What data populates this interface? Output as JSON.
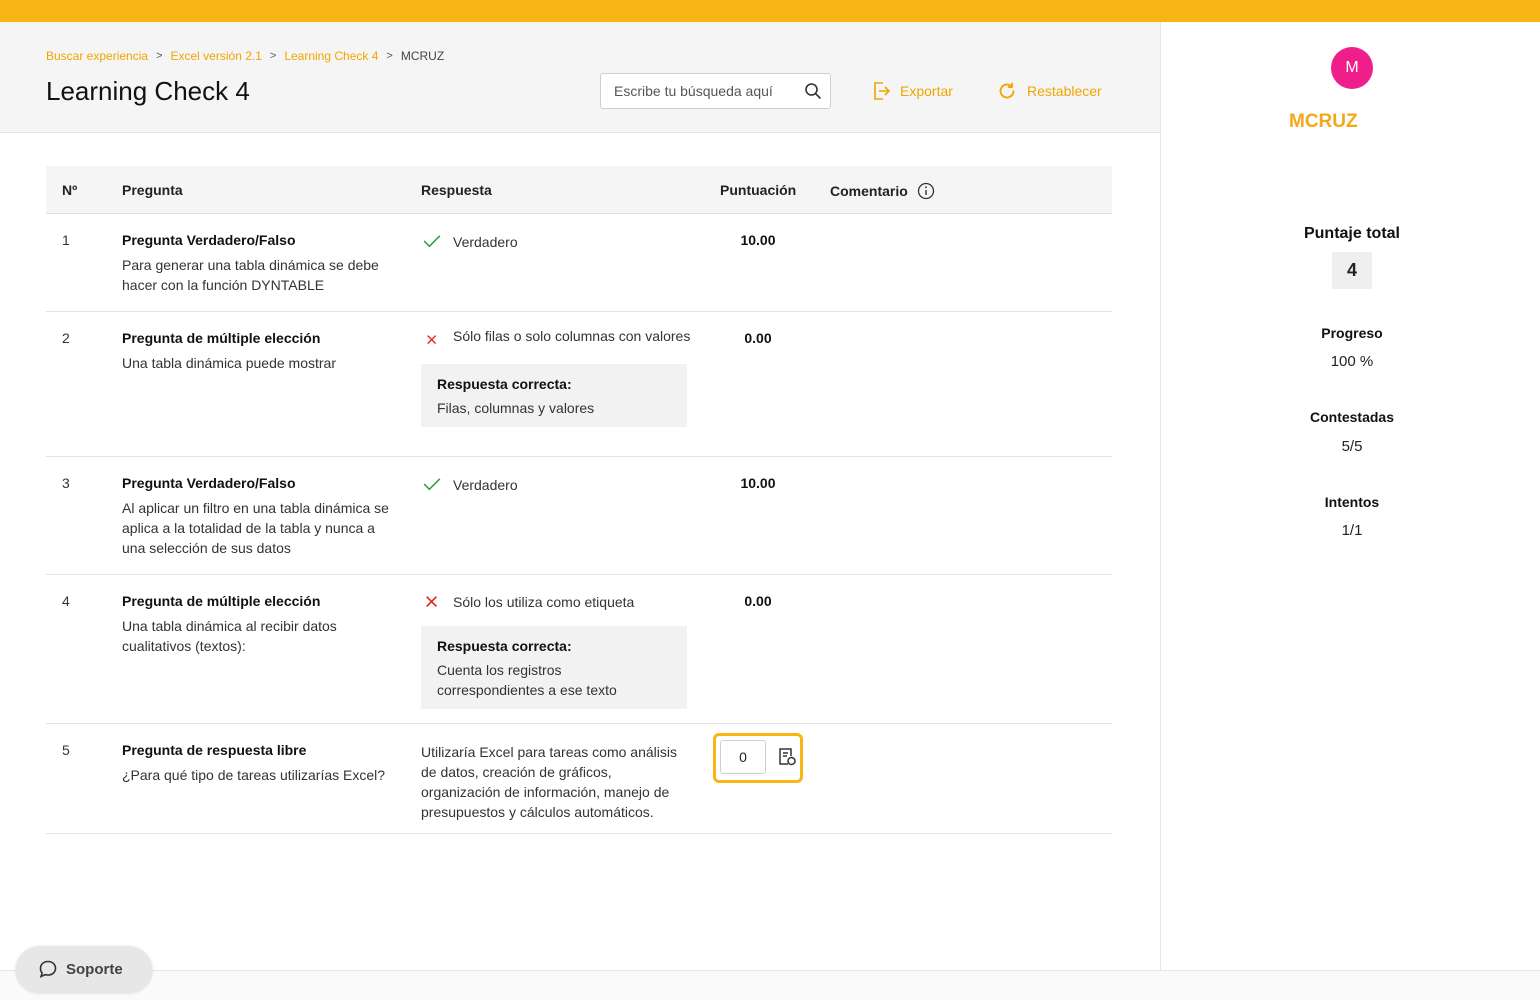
{
  "breadcrumb": {
    "items": [
      "Buscar experiencia",
      "Excel versión 2.1",
      "Learning Check 4"
    ],
    "current": "MCRUZ"
  },
  "page": {
    "title": "Learning Check 4"
  },
  "search": {
    "placeholder": "Escribe tu búsqueda aquí",
    "icon": "search-icon"
  },
  "actions": {
    "export_label": "Exportar",
    "reset_label": "Restablecer"
  },
  "table": {
    "headers": {
      "n": "Nº",
      "question": "Pregunta",
      "answer": "Respuesta",
      "score": "Puntuación",
      "comment": "Comentario"
    },
    "rows": [
      {
        "n": "1",
        "type": "Pregunta Verdadero/Falso",
        "text": "Para generar una tabla dinámica se debe hacer con la función DYNTABLE",
        "status": "correct",
        "answer": "Verdadero",
        "score": "10.00"
      },
      {
        "n": "2",
        "type": "Pregunta de múltiple elección",
        "text": "Una tabla dinámica puede mostrar",
        "status": "incorrect",
        "answer": "Sólo filas o solo columnas con valores",
        "correct_label": "Respuesta correcta:",
        "correct_answer": "Filas, columnas y valores",
        "score": "0.00"
      },
      {
        "n": "3",
        "type": "Pregunta Verdadero/Falso",
        "text": "Al aplicar un filtro en una tabla dinámica se aplica a la totalidad de la tabla y nunca a una selección de sus datos",
        "status": "correct",
        "answer": "Verdadero",
        "score": "10.00"
      },
      {
        "n": "4",
        "type": "Pregunta de múltiple elección",
        "text": "Una tabla dinámica al recibir datos cualitativos (textos):",
        "status": "incorrect",
        "answer": "Sólo los utiliza como etiqueta",
        "correct_label": "Respuesta correcta:",
        "correct_answer": "Cuenta los registros correspondientes a ese texto",
        "score": "0.00"
      },
      {
        "n": "5",
        "type": "Pregunta de respuesta libre",
        "text": "¿Para qué tipo de tareas utilizarías Excel?",
        "status": "free",
        "answer": "Utilizaría Excel para tareas como análisis de datos, creación de gráficos, organización de información, manejo de presupuestos y cálculos automáticos.",
        "score_input": "0"
      }
    ]
  },
  "sidebar": {
    "avatar_initial": "M",
    "username": "MCRUZ",
    "total_label": "Puntaje total",
    "total_value": "4",
    "progress_label": "Progreso",
    "progress_value": "100 %",
    "answered_label": "Contestadas",
    "answered_value": "5/5",
    "attempts_label": "Intentos",
    "attempts_value": "1/1"
  },
  "support": {
    "label": "Soporte"
  },
  "colors": {
    "accent": "#fbb415",
    "link": "#f0a500",
    "avatar": "#ee1f8b",
    "correct": "#2e9b3f",
    "incorrect": "#e02424"
  }
}
